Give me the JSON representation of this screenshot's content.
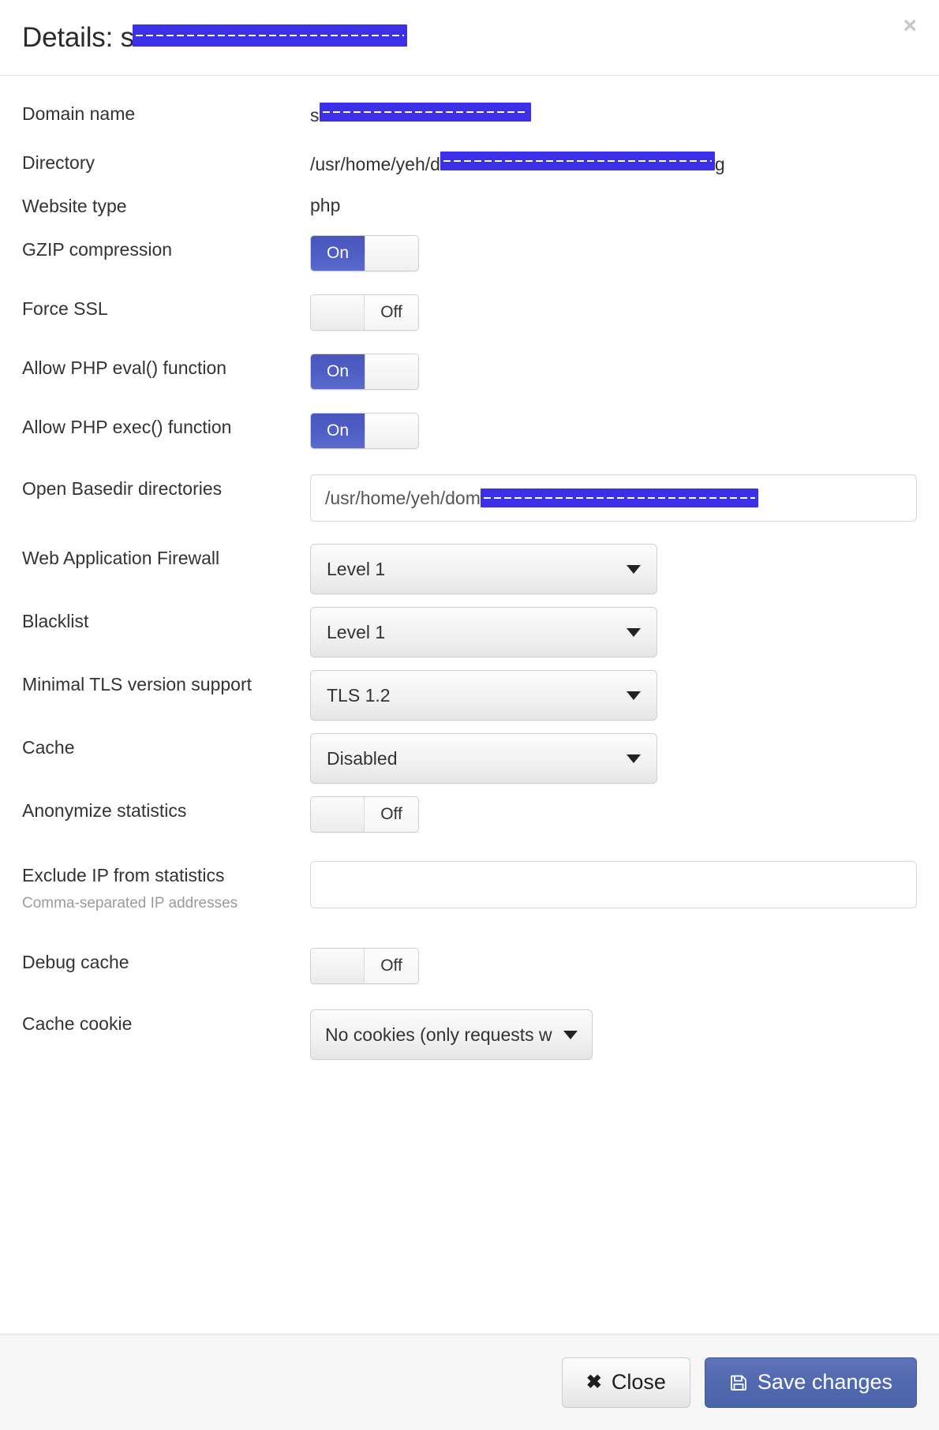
{
  "header": {
    "title_prefix": "Details: s",
    "title_redacted": "ample-domain-placeholder-redacted",
    "title_suffix": "",
    "close_icon": "close-icon",
    "close_label": "×"
  },
  "fields": {
    "domain_name": {
      "label": "Domain name",
      "value_prefix": "s",
      "value_redacted": "ample-redacted-domain-name.tld",
      "value_suffix": ""
    },
    "directory": {
      "label": "Directory",
      "value_prefix": "/usr/home/yeh/d",
      "value_redacted": "omains-redacted-path-segment-here",
      "value_suffix": "g"
    },
    "website_type": {
      "label": "Website type",
      "value": "php"
    },
    "gzip_compression": {
      "label": "GZIP compression",
      "state": "On",
      "on_label": "On",
      "off_label": "Off"
    },
    "force_ssl": {
      "label": "Force SSL",
      "state": "Off",
      "on_label": "On",
      "off_label": "Off"
    },
    "php_eval": {
      "label": "Allow PHP eval() function",
      "state": "On",
      "on_label": "On",
      "off_label": "Off"
    },
    "php_exec": {
      "label": "Allow PHP exec() function",
      "state": "On",
      "on_label": "On",
      "off_label": "Off"
    },
    "open_basedir": {
      "label": "Open Basedir directories",
      "value_prefix": "/usr/home/yeh/dom",
      "value_redacted": "ains-redacted-basedir-path-listing",
      "value_suffix": "",
      "placeholder": ""
    },
    "waf": {
      "label": "Web Application Firewall",
      "value": "Level 1"
    },
    "blacklist": {
      "label": "Blacklist",
      "value": "Level 1"
    },
    "min_tls": {
      "label": "Minimal TLS version support",
      "value": "TLS 1.2"
    },
    "cache": {
      "label": "Cache",
      "value": "Disabled"
    },
    "anonymize_statistics": {
      "label": "Anonymize statistics",
      "state": "Off",
      "on_label": "On",
      "off_label": "Off"
    },
    "exclude_ip": {
      "label": "Exclude IP from statistics",
      "sublabel": "Comma-separated IP addresses",
      "value": "",
      "placeholder": ""
    },
    "debug_cache": {
      "label": "Debug cache",
      "state": "Off",
      "on_label": "On",
      "off_label": "Off"
    },
    "cache_cookie": {
      "label": "Cache cookie",
      "value": "No cookies (only requests w"
    }
  },
  "footer": {
    "close_button": "Close",
    "close_icon": "cross-icon",
    "save_button": "Save changes",
    "save_icon": "floppy-save-icon"
  },
  "colors": {
    "accent_blue": "#4d5ec6",
    "primary_button": "#5068ae",
    "redaction": "#3b30e8",
    "label_text": "#333333",
    "muted_text": "#9b9b9b"
  }
}
